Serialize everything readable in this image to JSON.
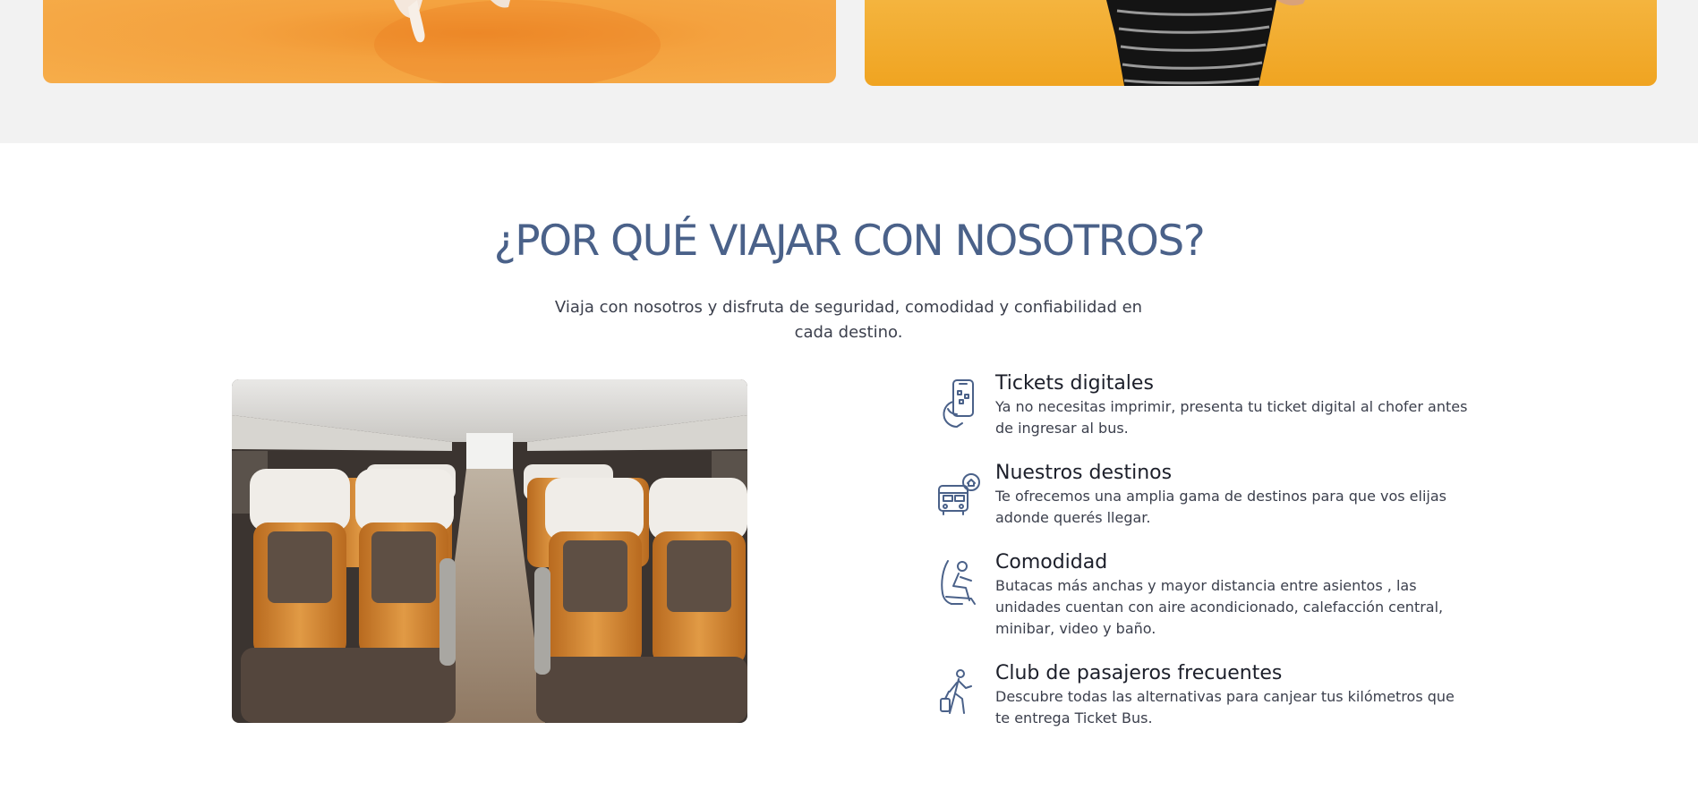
{
  "promos": {
    "left_card": {
      "icon": "promo-image-hands"
    },
    "right_card": {
      "icon": "promo-image-striped-shirt"
    }
  },
  "why_section": {
    "title": "¿POR QUÉ VIAJAR CON NOSOTROS?",
    "subtitle": "Viaja con nosotros y disfruta de seguridad, comodidad y confiabilidad en cada destino.",
    "image_icon": "bus-interior-photo"
  },
  "features": [
    {
      "icon": "digital-ticket-phone-icon",
      "title": "Tickets digitales",
      "text": "Ya no necesitas imprimir, presenta tu ticket digital al chofer antes de ingresar al bus."
    },
    {
      "icon": "bus-destination-icon",
      "title": "Nuestros destinos",
      "text": "Te ofrecemos una amplia gama de destinos para que vos elijas adonde querés llegar."
    },
    {
      "icon": "seated-passenger-icon",
      "title": "Comodidad",
      "text": "Butacas más anchas y mayor distancia entre asientos , las unidades cuentan con aire acondicionado, calefacción central, minibar, video y baño."
    },
    {
      "icon": "traveler-luggage-icon",
      "title": "Club de pasajeros frecuentes",
      "text": "Descubre todas las alternativas para canjear tus kilómetros que te entrega Ticket Bus."
    }
  ],
  "colors": {
    "title": "#4a6189",
    "icon_stroke": "#4a6189",
    "orange_card": "#f6ad4a",
    "yellow_card": "#f0a421",
    "band_bg": "#f2f2f2"
  }
}
